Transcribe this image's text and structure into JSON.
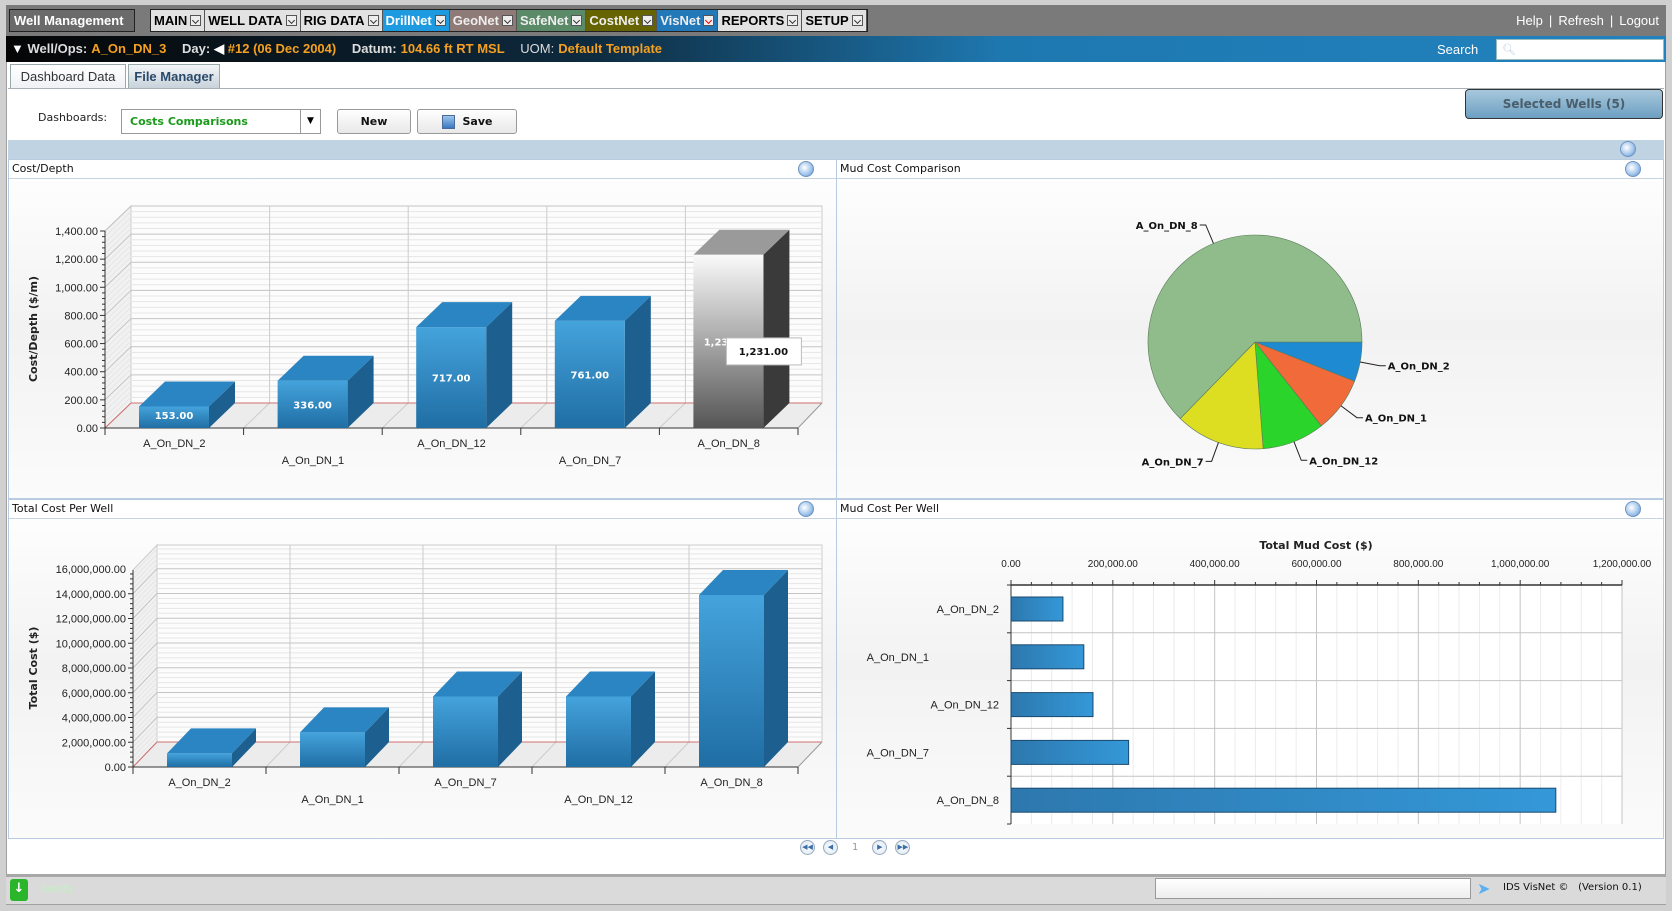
{
  "menubar": {
    "well_management": "Well Management",
    "items": [
      {
        "label": "MAIN",
        "bg": "#e2e2e2",
        "fg": "#000"
      },
      {
        "label": "WELL DATA",
        "bg": "#e2e2e2",
        "fg": "#000"
      },
      {
        "label": "RIG DATA",
        "bg": "#e2e2e2",
        "fg": "#000"
      },
      {
        "label": "DrillNet",
        "bg": "#1e9be0",
        "fg": "#fff"
      },
      {
        "label": "GeoNet",
        "bg": "#8e7a76",
        "fg": "#eee"
      },
      {
        "label": "SafeNet",
        "bg": "#5a8a68",
        "fg": "#eee"
      },
      {
        "label": "CostNet",
        "bg": "#666400",
        "fg": "#eee"
      },
      {
        "label": "VisNet",
        "bg": "#2378b8",
        "fg": "#eee"
      },
      {
        "label": "REPORTS",
        "bg": "#e2e2e2",
        "fg": "#000"
      },
      {
        "label": "SETUP",
        "bg": "#e2e2e2",
        "fg": "#000"
      }
    ],
    "links": [
      "Help",
      "|",
      "Refresh",
      "|",
      "Logout"
    ]
  },
  "infobar": {
    "well_label": "Well/Ops:",
    "well": "A_On_DN_3",
    "day_label": "Day:",
    "day": "#12 (06 Dec 2004)",
    "datum_label": "Datum:",
    "datum": "104.66 ft RT MSL",
    "uom_label": "UOM:",
    "uom": "Default Template",
    "search_label": "Search",
    "search_value": ""
  },
  "tabs": [
    "Dashboard Data",
    "File Manager"
  ],
  "toolbar": {
    "dashboards_label": "Dashboards:",
    "dashboard_selected": "Costs Comparisons",
    "new_label": "New",
    "save_label": "Save",
    "selected_wells": "Selected Wells (5)"
  },
  "panels": {
    "p1": "Cost/Depth",
    "p2": "Mud Cost Comparison",
    "p3": "Total Cost Per Well",
    "p4": "Mud Cost Per Well"
  },
  "pager": {
    "page": "1"
  },
  "status": {
    "ready": "Ready",
    "product": "IDS VisNet ©",
    "version": "(Version 0.1)"
  },
  "chart_data": [
    {
      "type": "bar",
      "title": "Cost/Depth",
      "ylabel": "Cost/Depth ($/m)",
      "ylim": [
        0,
        1400
      ],
      "yticks": [
        "0.00",
        "200.00",
        "400.00",
        "600.00",
        "800.00",
        "1,000.00",
        "1,200.00",
        "1,400.00"
      ],
      "categories": [
        "A_On_DN_2",
        "A_On_DN_1",
        "A_On_DN_12",
        "A_On_DN_7",
        "A_On_DN_8"
      ],
      "values": [
        153,
        336,
        717,
        761,
        1231
      ],
      "data_labels": [
        "153.00",
        "336.00",
        "717.00",
        "761.00",
        "1,231.00"
      ],
      "highlighted": "A_On_DN_8",
      "tooltip": "1,231.00",
      "grid": true,
      "style": "3d"
    },
    {
      "type": "pie",
      "title": "Mud Cost Comparison",
      "categories": [
        "A_On_DN_2",
        "A_On_DN_1",
        "A_On_DN_12",
        "A_On_DN_7",
        "A_On_DN_8"
      ],
      "values": [
        102000,
        143000,
        161000,
        231000,
        1070000
      ],
      "colors": [
        "#1e8ad2",
        "#f06a3a",
        "#2ad42a",
        "#dddd22",
        "#8fbc8a"
      ]
    },
    {
      "type": "bar",
      "title": "Total Cost Per Well",
      "ylabel": "Total Cost ($)",
      "ylim": [
        0,
        16000000
      ],
      "yticks": [
        "0.00",
        "2,000,000.00",
        "4,000,000.00",
        "6,000,000.00",
        "8,000,000.00",
        "10,000,000.00",
        "12,000,000.00",
        "14,000,000.00",
        "16,000,000.00"
      ],
      "categories": [
        "A_On_DN_2",
        "A_On_DN_1",
        "A_On_DN_7",
        "A_On_DN_12",
        "A_On_DN_8"
      ],
      "values": [
        1100000,
        2800000,
        5700000,
        5700000,
        13900000
      ],
      "grid": true,
      "style": "3d"
    },
    {
      "type": "bar",
      "orientation": "horizontal",
      "title": "Mud Cost Per Well",
      "xlabel": "Total Mud Cost ($)",
      "xlim": [
        0,
        1200000
      ],
      "xticks": [
        "0.00",
        "200,000.00",
        "400,000.00",
        "600,000.00",
        "800,000.00",
        "1,000,000.00",
        "1,200,000.00"
      ],
      "categories": [
        "A_On_DN_2",
        "A_On_DN_1",
        "A_On_DN_12",
        "A_On_DN_7",
        "A_On_DN_8"
      ],
      "values": [
        102000,
        143000,
        161000,
        231000,
        1070000
      ],
      "grid": true
    }
  ]
}
